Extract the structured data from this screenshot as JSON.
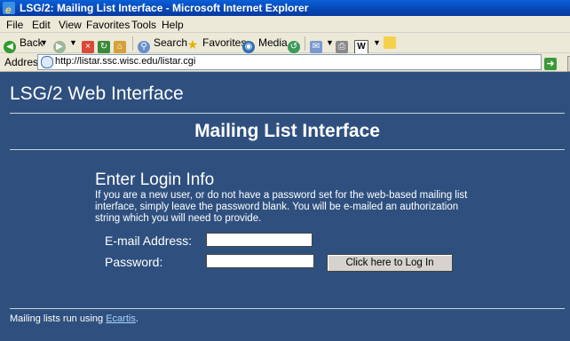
{
  "window": {
    "title": "LSG/2: Mailing List Interface - Microsoft Internet Explorer"
  },
  "menu": [
    "File",
    "Edit",
    "View",
    "Favorites",
    "Tools",
    "Help"
  ],
  "toolbar": {
    "back_label": "Back",
    "search_label": "Search",
    "favorites_label": "Favorites",
    "media_label": "Media"
  },
  "address": {
    "label": "Address",
    "url": "http://listar.ssc.wisc.edu/listar.cgi",
    "go_label": "Go"
  },
  "page": {
    "site_title": "LSG/2 Web Interface",
    "heading": "Mailing List Interface",
    "login_heading": "Enter Login Info",
    "login_description": "If you are a new user, or do not have a password set for the web-based mailing list interface, simply leave the password blank. You will be e-mailed an authorization string which you will need to provide.",
    "email_label": "E-mail Address:",
    "password_label": "Password:",
    "login_button": "Click here to Log In",
    "footer_text": "Mailing lists run using",
    "footer_link": "Ecartis",
    "footer_suffix": "."
  },
  "colors": {
    "page_background": "#2f507f",
    "titlebar": "#0846b4",
    "chrome": "#ece9d8"
  }
}
